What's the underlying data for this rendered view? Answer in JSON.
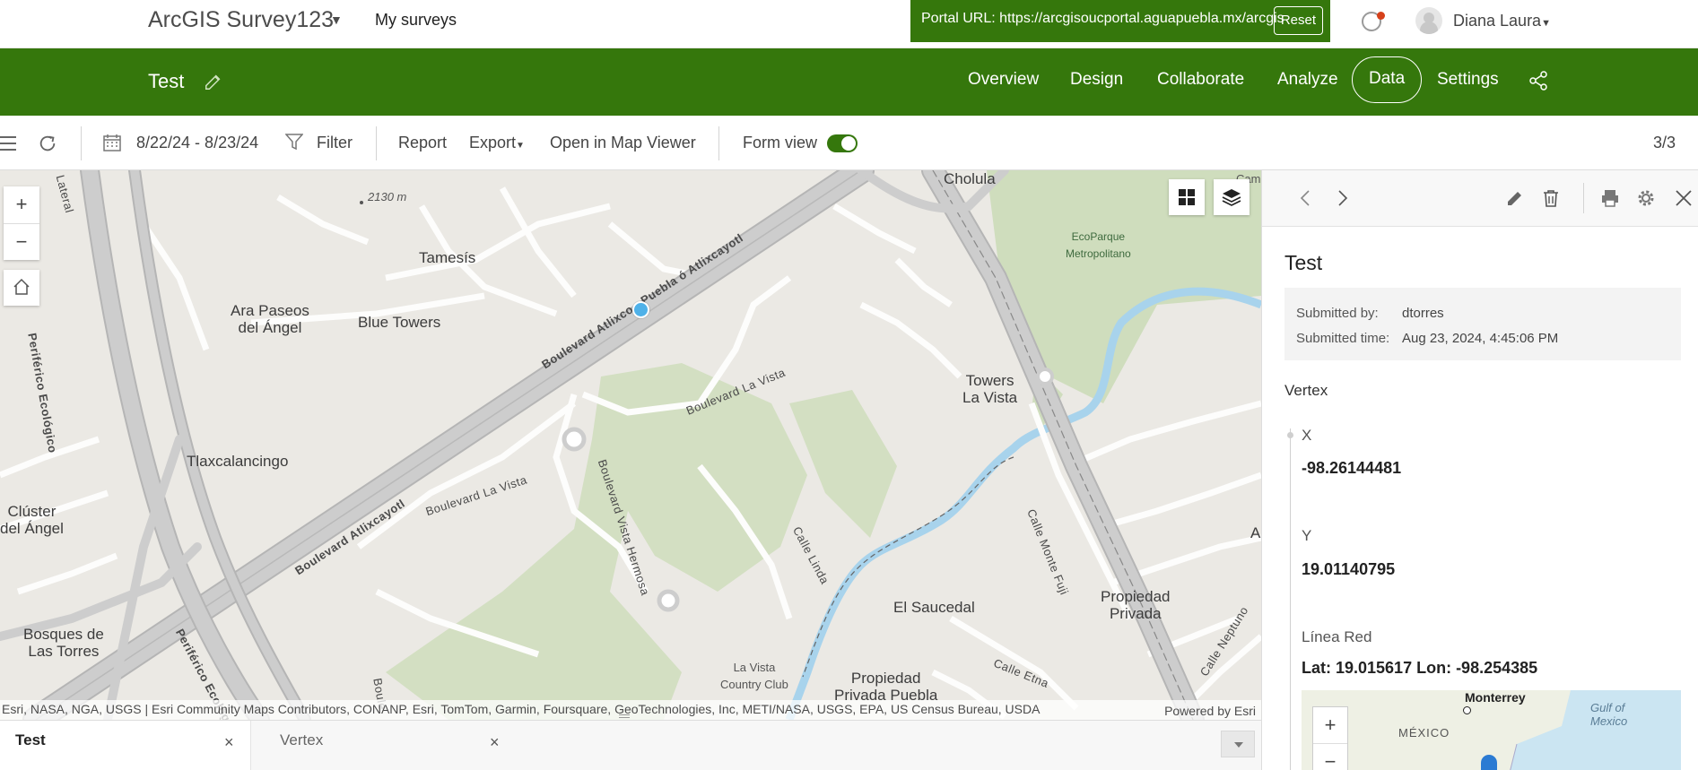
{
  "topbar": {
    "app_title": "ArcGIS Survey123",
    "my_surveys": "My surveys",
    "portal_text": "Portal URL: https://arcgisoucportal.aguapuebla.mx/arcgis",
    "reset_label": "Reset",
    "username": "Diana Laura"
  },
  "header": {
    "survey_title": "Test",
    "tabs": [
      "Overview",
      "Design",
      "Collaborate",
      "Analyze",
      "Data",
      "Settings"
    ],
    "active_tab": "Data"
  },
  "toolbar": {
    "date_range": "8/22/24 - 8/23/24",
    "filter_label": "Filter",
    "report_label": "Report",
    "export_label": "Export",
    "map_viewer_label": "Open in Map Viewer",
    "form_view_label": "Form view",
    "form_view_on": true,
    "record_counter": "3/3"
  },
  "map": {
    "labels": {
      "cholula": "Cholula",
      "elevation": "2130 m",
      "tamesis": "Tamesís",
      "ara_paseos": "Ara Paseos\ndel Ángel",
      "blue_towers": "Blue Towers",
      "periferico": "Periférico Ecológico",
      "periferico2": "Periférico Ecológic",
      "tlaxcalancingo": "Tlaxcalancingo",
      "cluster": "Clúster\ndel Ángel",
      "bosques": "Bosques de\nLas Torres",
      "blvd_atlixco": "Boulevard Atlixco - Puebla ó Atlixcayotl",
      "blvd_atlixcayotl": "Boulevard Atlixcayotl",
      "blvd_la_vista": "Boulevard La Vista",
      "blvd_la_vista2": "Boulevard La Vista",
      "blvd_vista_hermosa": "Boulevard Vista Hermosa",
      "calle_linda": "Calle Linda",
      "ecoparque": "EcoParque\nMetropolitano",
      "towers_la_vista": "Towers\nLa Vista",
      "calle_monte_fuji": "Calle Monte Fuji",
      "el_saucedal": "El Saucedal",
      "propiedad_privada": "Propiedad\nPrivada",
      "propiedad_privada_puebla": "Propiedad\nPrivada Puebla",
      "la_vista_cc": "La Vista\nCountry Club",
      "calle_etna": "Calle Etna",
      "calle_neptuno": "Calle Neptuno",
      "lateral": "Lateral",
      "cam": "Cam",
      "a_edge": "A",
      "boule": "Boule"
    },
    "attribution": "Esri, NASA, NGA, USGS | Esri Community Maps Contributors, CONANP, Esri, TomTom, Garmin, Foursquare, GeoTechnologies, Inc, METI/NASA, USGS, EPA, US Census Bureau, USDA",
    "powered_by": "Powered by Esri",
    "colors": {
      "land": "#ebe9e4",
      "park": "#cfddbd",
      "road": "#c9c9c9",
      "road_casing": "#b5b5b5",
      "river": "#a8d3ec",
      "point": "#4fb1e8"
    }
  },
  "panel": {
    "record_title": "Test",
    "submitted_by_label": "Submitted by:",
    "submitted_by": "dtorres",
    "submitted_time_label": "Submitted time:",
    "submitted_time": "Aug 23, 2024, 4:45:06 PM",
    "section": "Vertex",
    "fields": [
      {
        "label": "X",
        "value": "-98.26144481"
      },
      {
        "label": "Y",
        "value": "19.01140795"
      },
      {
        "label": "Línea Red",
        "value": "Lat: 19.015617 Lon: -98.254385"
      }
    ],
    "minimap": {
      "label_monterrey": "Monterrey",
      "label_mexico": "MÉXICO",
      "label_gulf": "Gulf of\nMexico"
    }
  },
  "bottom_tabs": [
    {
      "label": "Test",
      "active": true
    },
    {
      "label": "Vertex",
      "active": false
    }
  ]
}
